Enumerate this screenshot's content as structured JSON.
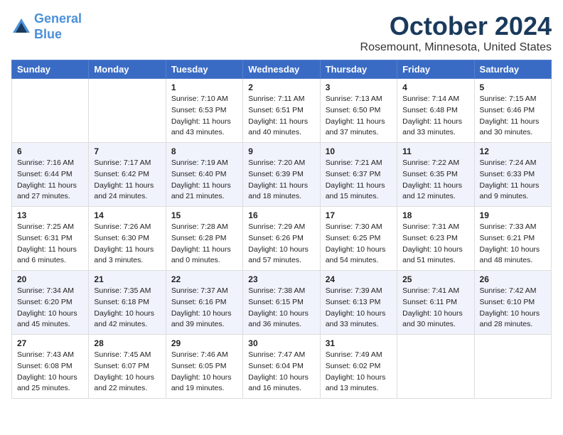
{
  "logo": {
    "line1": "General",
    "line2": "Blue"
  },
  "title": "October 2024",
  "subtitle": "Rosemount, Minnesota, United States",
  "weekdays": [
    "Sunday",
    "Monday",
    "Tuesday",
    "Wednesday",
    "Thursday",
    "Friday",
    "Saturday"
  ],
  "weeks": [
    [
      {
        "day": "",
        "sunrise": "",
        "sunset": "",
        "daylight": ""
      },
      {
        "day": "",
        "sunrise": "",
        "sunset": "",
        "daylight": ""
      },
      {
        "day": "1",
        "sunrise": "Sunrise: 7:10 AM",
        "sunset": "Sunset: 6:53 PM",
        "daylight": "Daylight: 11 hours and 43 minutes."
      },
      {
        "day": "2",
        "sunrise": "Sunrise: 7:11 AM",
        "sunset": "Sunset: 6:51 PM",
        "daylight": "Daylight: 11 hours and 40 minutes."
      },
      {
        "day": "3",
        "sunrise": "Sunrise: 7:13 AM",
        "sunset": "Sunset: 6:50 PM",
        "daylight": "Daylight: 11 hours and 37 minutes."
      },
      {
        "day": "4",
        "sunrise": "Sunrise: 7:14 AM",
        "sunset": "Sunset: 6:48 PM",
        "daylight": "Daylight: 11 hours and 33 minutes."
      },
      {
        "day": "5",
        "sunrise": "Sunrise: 7:15 AM",
        "sunset": "Sunset: 6:46 PM",
        "daylight": "Daylight: 11 hours and 30 minutes."
      }
    ],
    [
      {
        "day": "6",
        "sunrise": "Sunrise: 7:16 AM",
        "sunset": "Sunset: 6:44 PM",
        "daylight": "Daylight: 11 hours and 27 minutes."
      },
      {
        "day": "7",
        "sunrise": "Sunrise: 7:17 AM",
        "sunset": "Sunset: 6:42 PM",
        "daylight": "Daylight: 11 hours and 24 minutes."
      },
      {
        "day": "8",
        "sunrise": "Sunrise: 7:19 AM",
        "sunset": "Sunset: 6:40 PM",
        "daylight": "Daylight: 11 hours and 21 minutes."
      },
      {
        "day": "9",
        "sunrise": "Sunrise: 7:20 AM",
        "sunset": "Sunset: 6:39 PM",
        "daylight": "Daylight: 11 hours and 18 minutes."
      },
      {
        "day": "10",
        "sunrise": "Sunrise: 7:21 AM",
        "sunset": "Sunset: 6:37 PM",
        "daylight": "Daylight: 11 hours and 15 minutes."
      },
      {
        "day": "11",
        "sunrise": "Sunrise: 7:22 AM",
        "sunset": "Sunset: 6:35 PM",
        "daylight": "Daylight: 11 hours and 12 minutes."
      },
      {
        "day": "12",
        "sunrise": "Sunrise: 7:24 AM",
        "sunset": "Sunset: 6:33 PM",
        "daylight": "Daylight: 11 hours and 9 minutes."
      }
    ],
    [
      {
        "day": "13",
        "sunrise": "Sunrise: 7:25 AM",
        "sunset": "Sunset: 6:31 PM",
        "daylight": "Daylight: 11 hours and 6 minutes."
      },
      {
        "day": "14",
        "sunrise": "Sunrise: 7:26 AM",
        "sunset": "Sunset: 6:30 PM",
        "daylight": "Daylight: 11 hours and 3 minutes."
      },
      {
        "day": "15",
        "sunrise": "Sunrise: 7:28 AM",
        "sunset": "Sunset: 6:28 PM",
        "daylight": "Daylight: 11 hours and 0 minutes."
      },
      {
        "day": "16",
        "sunrise": "Sunrise: 7:29 AM",
        "sunset": "Sunset: 6:26 PM",
        "daylight": "Daylight: 10 hours and 57 minutes."
      },
      {
        "day": "17",
        "sunrise": "Sunrise: 7:30 AM",
        "sunset": "Sunset: 6:25 PM",
        "daylight": "Daylight: 10 hours and 54 minutes."
      },
      {
        "day": "18",
        "sunrise": "Sunrise: 7:31 AM",
        "sunset": "Sunset: 6:23 PM",
        "daylight": "Daylight: 10 hours and 51 minutes."
      },
      {
        "day": "19",
        "sunrise": "Sunrise: 7:33 AM",
        "sunset": "Sunset: 6:21 PM",
        "daylight": "Daylight: 10 hours and 48 minutes."
      }
    ],
    [
      {
        "day": "20",
        "sunrise": "Sunrise: 7:34 AM",
        "sunset": "Sunset: 6:20 PM",
        "daylight": "Daylight: 10 hours and 45 minutes."
      },
      {
        "day": "21",
        "sunrise": "Sunrise: 7:35 AM",
        "sunset": "Sunset: 6:18 PM",
        "daylight": "Daylight: 10 hours and 42 minutes."
      },
      {
        "day": "22",
        "sunrise": "Sunrise: 7:37 AM",
        "sunset": "Sunset: 6:16 PM",
        "daylight": "Daylight: 10 hours and 39 minutes."
      },
      {
        "day": "23",
        "sunrise": "Sunrise: 7:38 AM",
        "sunset": "Sunset: 6:15 PM",
        "daylight": "Daylight: 10 hours and 36 minutes."
      },
      {
        "day": "24",
        "sunrise": "Sunrise: 7:39 AM",
        "sunset": "Sunset: 6:13 PM",
        "daylight": "Daylight: 10 hours and 33 minutes."
      },
      {
        "day": "25",
        "sunrise": "Sunrise: 7:41 AM",
        "sunset": "Sunset: 6:11 PM",
        "daylight": "Daylight: 10 hours and 30 minutes."
      },
      {
        "day": "26",
        "sunrise": "Sunrise: 7:42 AM",
        "sunset": "Sunset: 6:10 PM",
        "daylight": "Daylight: 10 hours and 28 minutes."
      }
    ],
    [
      {
        "day": "27",
        "sunrise": "Sunrise: 7:43 AM",
        "sunset": "Sunset: 6:08 PM",
        "daylight": "Daylight: 10 hours and 25 minutes."
      },
      {
        "day": "28",
        "sunrise": "Sunrise: 7:45 AM",
        "sunset": "Sunset: 6:07 PM",
        "daylight": "Daylight: 10 hours and 22 minutes."
      },
      {
        "day": "29",
        "sunrise": "Sunrise: 7:46 AM",
        "sunset": "Sunset: 6:05 PM",
        "daylight": "Daylight: 10 hours and 19 minutes."
      },
      {
        "day": "30",
        "sunrise": "Sunrise: 7:47 AM",
        "sunset": "Sunset: 6:04 PM",
        "daylight": "Daylight: 10 hours and 16 minutes."
      },
      {
        "day": "31",
        "sunrise": "Sunrise: 7:49 AM",
        "sunset": "Sunset: 6:02 PM",
        "daylight": "Daylight: 10 hours and 13 minutes."
      },
      {
        "day": "",
        "sunrise": "",
        "sunset": "",
        "daylight": ""
      },
      {
        "day": "",
        "sunrise": "",
        "sunset": "",
        "daylight": ""
      }
    ]
  ]
}
